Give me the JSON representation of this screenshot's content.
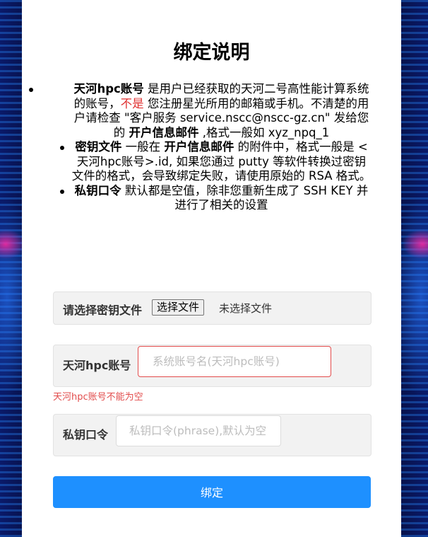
{
  "title": "绑定说明",
  "instructions": {
    "item1": {
      "bold_start": "天河hpc账号",
      "text1": " 是用户已经获取的天河二号高性能计算系统的账号，",
      "red": "不是",
      "text2": " 您注册星光所用的邮箱或手机。不清楚的用户请检查 \"客户服务 service.nscc@nscc-gz.cn\" 发给您的 ",
      "bold_end": "开户信息邮件",
      "text3": " ,格式一般如 xyz_npq_1"
    },
    "item2": {
      "bold_start": "密钥文件",
      "text1": " 一般在 ",
      "bold_mid": "开户信息邮件",
      "text2": " 的附件中，格式一般是 < 天河hpc账号>.id, 如果您通过 putty 等软件转换过密钥文件的格式，会导致绑定失败，请使用原始的 RSA 格式。"
    },
    "item3": {
      "bold_start": "私钥口令",
      "text1": " 默认都是空值，除非您重新生成了 SSH KEY 并进行了相关的设置"
    }
  },
  "form": {
    "key_file": {
      "label": "请选择密钥文件",
      "button": "选择文件",
      "status": "未选择文件"
    },
    "account": {
      "label": "天河hpc账号",
      "placeholder": "系统账号名(天河hpc账号)",
      "value": "",
      "error": "天河hpc账号不能为空"
    },
    "phrase": {
      "label": "私钥口令",
      "placeholder": "私钥口令(phrase),默认为空",
      "value": ""
    },
    "submit_label": "绑定"
  },
  "colors": {
    "primary": "#1e90ff",
    "error": "#e24c4c",
    "highlight": "#e03030"
  }
}
